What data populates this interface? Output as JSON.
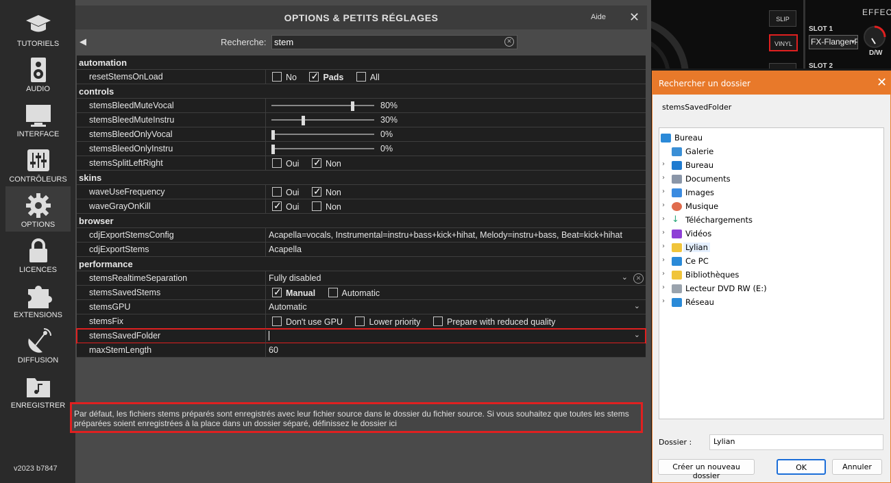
{
  "sidebar": {
    "items": [
      {
        "label": "TUTORIELS",
        "icon": "graduation-cap-icon"
      },
      {
        "label": "AUDIO",
        "icon": "speaker-icon"
      },
      {
        "label": "INTERFACE",
        "icon": "monitor-icon"
      },
      {
        "label": "CONTRÔLEURS",
        "icon": "sliders-icon"
      },
      {
        "label": "OPTIONS",
        "icon": "gear-icon"
      },
      {
        "label": "LICENCES",
        "icon": "lock-icon"
      },
      {
        "label": "EXTENSIONS",
        "icon": "puzzle-icon"
      },
      {
        "label": "DIFFUSION",
        "icon": "satellite-dish-icon"
      },
      {
        "label": "ENREGISTRER",
        "icon": "music-folder-icon"
      }
    ],
    "active": "OPTIONS",
    "version": "v2023 b7847"
  },
  "options": {
    "title": "OPTIONS & PETITS RÉGLAGES",
    "help": "Aide",
    "close": "✕",
    "back": "◀",
    "search_label": "Recherche:",
    "search_value": "stem",
    "sections": {
      "automation": "automation",
      "controls": "controls",
      "skins": "skins",
      "browser": "browser",
      "performance": "performance"
    },
    "rows": {
      "resetStemsOnLoad": {
        "name": "resetStemsOnLoad",
        "opts": [
          "No",
          "Pads",
          "All"
        ]
      },
      "stemsBleedMuteVocal": {
        "name": "stemsBleedMuteVocal",
        "value": "80%",
        "level": 0.8
      },
      "stemsBleedMuteInstru": {
        "name": "stemsBleedMuteInstru",
        "value": "30%",
        "level": 0.3
      },
      "stemsBleedOnlyVocal": {
        "name": "stemsBleedOnlyVocal",
        "value": "0%",
        "level": 0
      },
      "stemsBleedOnlyInstru": {
        "name": "stemsBleedOnlyInstru",
        "value": "0%",
        "level": 0
      },
      "stemsSplitLeftRight": {
        "name": "stemsSplitLeftRight",
        "opts": [
          "Oui",
          "Non"
        ]
      },
      "waveUseFrequency": {
        "name": "waveUseFrequency",
        "opts": [
          "Oui",
          "Non"
        ]
      },
      "waveGrayOnKill": {
        "name": "waveGrayOnKill",
        "opts": [
          "Oui",
          "Non"
        ]
      },
      "cdjExportStemsConfig": {
        "name": "cdjExportStemsConfig",
        "value": "Acapella=vocals, Instrumental=instru+bass+kick+hihat, Melody=instru+bass, Beat=kick+hihat"
      },
      "cdjExportStems": {
        "name": "cdjExportStems",
        "value": "Acapella"
      },
      "stemsRealtimeSeparation": {
        "name": "stemsRealtimeSeparation",
        "value": "Fully disabled"
      },
      "stemsSavedStems": {
        "name": "stemsSavedStems",
        "opts": [
          "Manual",
          "Automatic"
        ]
      },
      "stemsGPU": {
        "name": "stemsGPU",
        "value": "Automatic"
      },
      "stemsFix": {
        "name": "stemsFix",
        "opts": [
          "Don't use GPU",
          "Lower priority",
          "Prepare with reduced quality"
        ]
      },
      "stemsSavedFolder": {
        "name": "stemsSavedFolder",
        "value": ""
      },
      "maxStemLength": {
        "name": "maxStemLength",
        "value": "60"
      }
    },
    "description": "Par défaut, les fichiers stems préparés sont enregistrés avec leur fichier source dans le dossier du fichier source. Si vous souhaitez que toutes les stems préparées soient enregistrées à la place dans un dossier séparé, définissez le dossier ici"
  },
  "deck": {
    "slip": "SLIP",
    "vinyl": "VINYL",
    "effect": "EFFECT",
    "slot1": "SLOT 1",
    "slot1_value": "FX-Flanger P",
    "slot2": "SLOT 2",
    "dw": "D/W"
  },
  "dialog": {
    "title": "Rechercher un dossier",
    "close": "✕",
    "description": "stemsSavedFolder",
    "tree": [
      {
        "label": "Bureau",
        "icon": "desktop-icon",
        "color": "#2b8ad8"
      },
      {
        "label": "Galerie",
        "icon": "gallery-icon",
        "color": "#3a8fd6"
      },
      {
        "label": "Bureau",
        "icon": "desktop-folder-icon",
        "color": "#1f7bd0"
      },
      {
        "label": "Documents",
        "icon": "documents-icon",
        "color": "#8a96a8"
      },
      {
        "label": "Images",
        "icon": "images-icon",
        "color": "#3b8be0"
      },
      {
        "label": "Musique",
        "icon": "music-icon",
        "color": "#e06c4d"
      },
      {
        "label": "Téléchargements",
        "icon": "download-icon",
        "color": "#2aa77a"
      },
      {
        "label": "Vidéos",
        "icon": "videos-icon",
        "color": "#8e3fd6"
      },
      {
        "label": "Lylian",
        "icon": "user-folder-icon",
        "color": "#f0c43a"
      },
      {
        "label": "Ce PC",
        "icon": "computer-icon",
        "color": "#2a8ad8"
      },
      {
        "label": "Bibliothèques",
        "icon": "libraries-folder-icon",
        "color": "#f0c43a"
      },
      {
        "label": "Lecteur DVD RW (E:)",
        "icon": "dvd-drive-icon",
        "color": "#9aa3ad"
      },
      {
        "label": "Réseau",
        "icon": "network-icon",
        "color": "#2a8ad8"
      }
    ],
    "folder_label": "Dossier :",
    "folder_value": "Lylian",
    "new_folder": "Créer un nouveau dossier",
    "ok": "OK",
    "cancel": "Annuler"
  }
}
